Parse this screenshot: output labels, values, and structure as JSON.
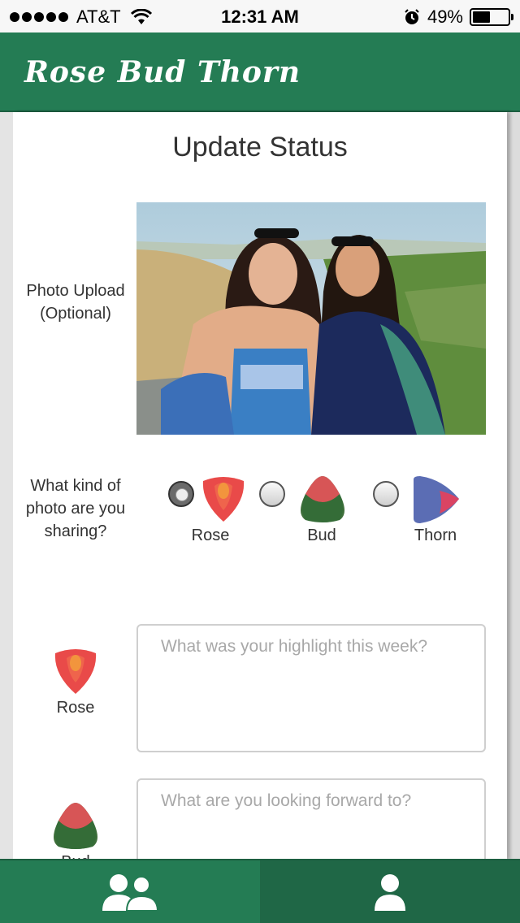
{
  "status_bar": {
    "carrier": "AT&T",
    "time": "12:31 AM",
    "battery": "49%",
    "battery_level": 0.49,
    "signal_bars": 5
  },
  "header": {
    "title": "Rose Bud Thorn"
  },
  "page": {
    "title": "Update Status"
  },
  "photo_upload": {
    "label": "Photo Upload (Optional)"
  },
  "photo_type": {
    "question": "What kind of photo are you sharing?",
    "options": [
      {
        "label": "Rose",
        "checked": true,
        "icon": "rose-icon"
      },
      {
        "label": "Bud",
        "checked": false,
        "icon": "bud-icon"
      },
      {
        "label": "Thorn",
        "checked": false,
        "icon": "thorn-icon"
      }
    ]
  },
  "rose_entry": {
    "label": "Rose",
    "placeholder": "What was your highlight this week?"
  },
  "bud_entry": {
    "label": "Bud",
    "placeholder": "What are you looking forward to?"
  },
  "tabs": [
    {
      "icon": "group-icon",
      "active": false
    },
    {
      "icon": "profile-icon",
      "active": true
    }
  ],
  "colors": {
    "brand_green": "#247c54",
    "rose_red": "#e8403f",
    "bud_green": "#3f6b3c",
    "thorn_blue": "#5b6db4"
  }
}
